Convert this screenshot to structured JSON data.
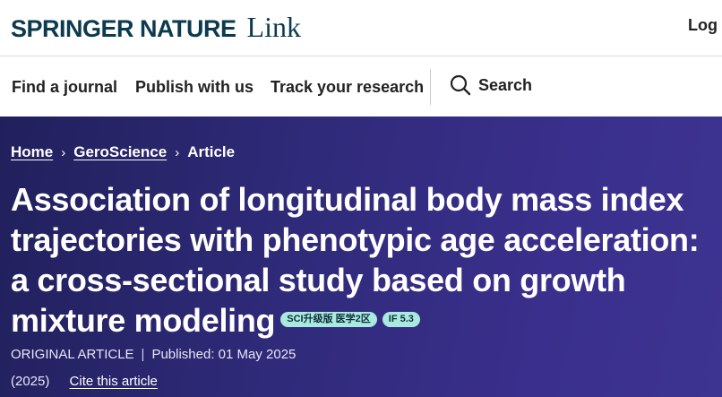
{
  "header": {
    "brand": "SPRINGER NATURE",
    "product": "Link",
    "login": "Log i"
  },
  "nav": {
    "items": [
      "Find a journal",
      "Publish with us",
      "Track your research"
    ],
    "search_label": "Search"
  },
  "breadcrumb": {
    "home": "Home",
    "journal": "GeroScience",
    "current": "Article",
    "separator": "›"
  },
  "article": {
    "title": "Association of longitudinal body mass index trajectories with phenotypic age acceleration: a cross-sectional study based on growth mixture modeling",
    "badges": [
      "SCI升级版 医学2区",
      "IF 5.3"
    ],
    "type": "ORIGINAL ARTICLE",
    "published": "Published: 01 May 2025",
    "year": "(2025)",
    "cite_label": "Cite this article"
  },
  "colors": {
    "brand": "#0c3a4e",
    "hero_bg": "#2f2a79",
    "badge_bg": "#a9e9e0"
  }
}
